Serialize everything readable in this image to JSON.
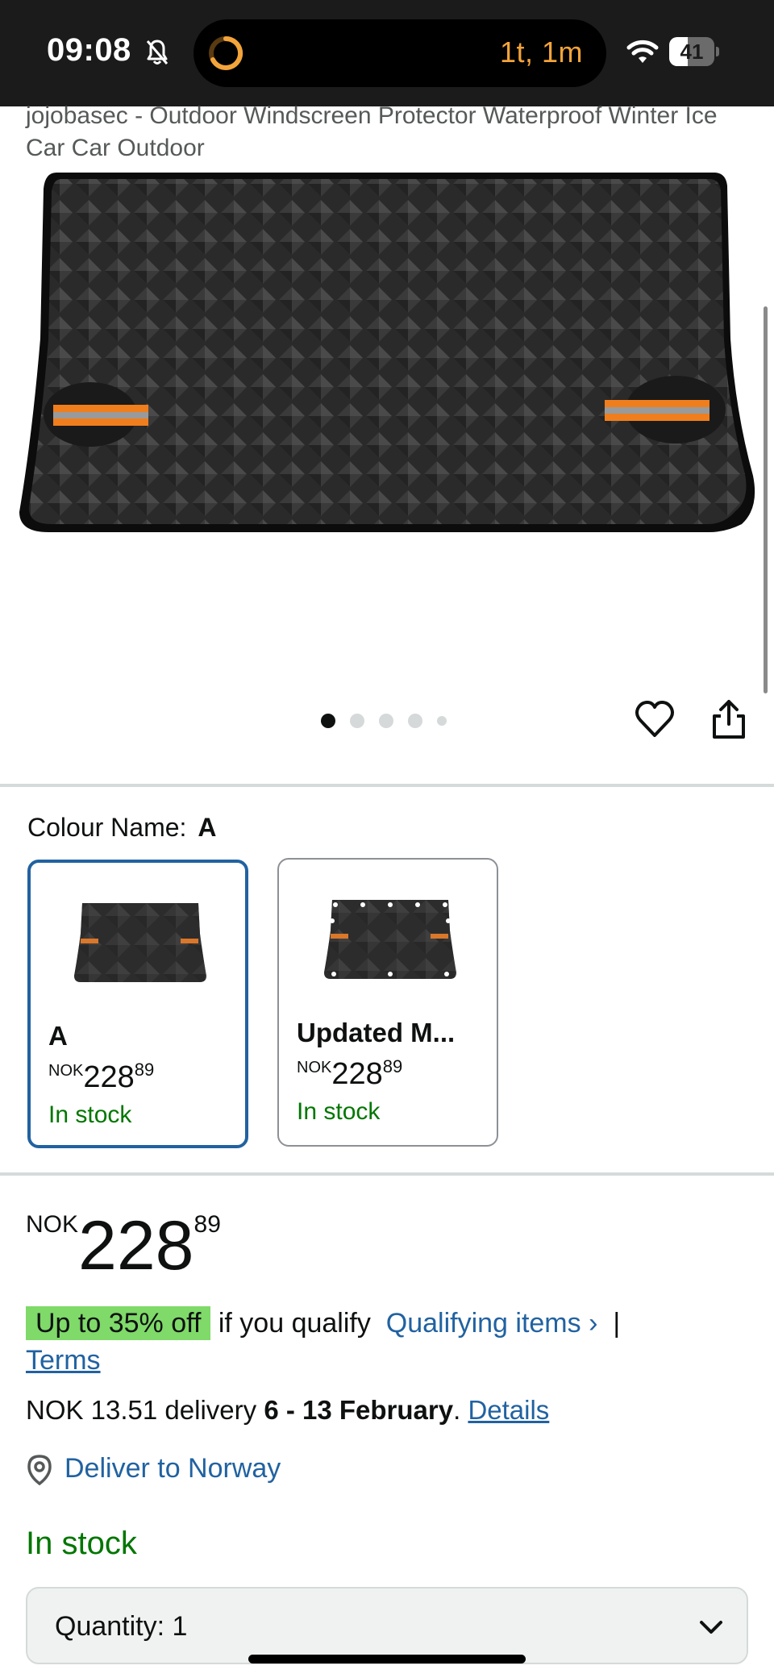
{
  "status_bar": {
    "time": "09:08",
    "timer": "1t, 1m",
    "battery": "41",
    "battery_level": 0.41,
    "icons": [
      "bell-muted-icon",
      "timer-ring-icon",
      "wifi-icon",
      "battery-icon"
    ]
  },
  "product": {
    "title": "jojobasec - Outdoor Windscreen Protector Waterproof Winter Ice Car Car Outdoor",
    "image_count": 5,
    "active_image": 1,
    "actions": [
      "heart-icon",
      "share-icon"
    ]
  },
  "variation": {
    "label": "Colour Name:",
    "selected_value": "A",
    "options": [
      {
        "name": "A",
        "currency": "NOK",
        "whole": "228",
        "fraction": "89",
        "stock": "In stock"
      },
      {
        "name": "Updated M...",
        "currency": "NOK",
        "whole": "228",
        "fraction": "89",
        "stock": "In stock"
      }
    ]
  },
  "price": {
    "currency": "NOK",
    "whole": "228",
    "fraction": "89"
  },
  "offer": {
    "badge": "Up to 35% off",
    "text": "if you qualify",
    "link": "Qualifying items",
    "chevron": "›",
    "separator": "|",
    "terms": "Terms"
  },
  "delivery": {
    "prefix": "NOK 13.51 delivery",
    "dates": "6 - 13 February",
    "punct": ".",
    "details": "Details",
    "deliver_to": "Deliver to Norway"
  },
  "stock_status": "In stock",
  "quantity": {
    "label": "Quantity:",
    "value": "1"
  },
  "colors": {
    "accent_link": "#2162a1",
    "in_stock": "#007600",
    "deal_badge": "#7fda69",
    "selected_border": "#2162a1",
    "timer_orange": "#f3a43a"
  }
}
